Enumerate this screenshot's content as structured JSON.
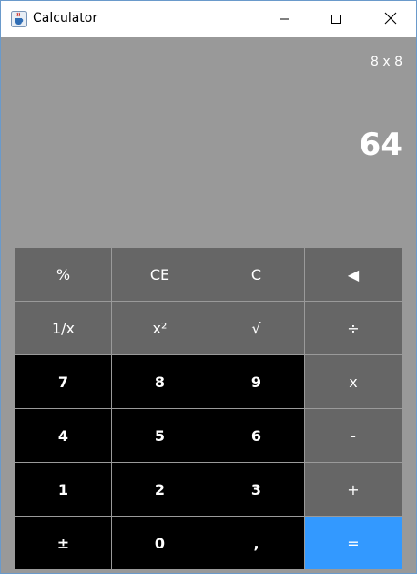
{
  "window": {
    "title": "Calculator"
  },
  "display": {
    "expression": "8 x 8",
    "result": "64"
  },
  "keypad": {
    "rows": [
      [
        {
          "label": "%",
          "kind": "fn"
        },
        {
          "label": "CE",
          "kind": "fn"
        },
        {
          "label": "C",
          "kind": "fn"
        },
        {
          "label": "◀",
          "kind": "fn"
        }
      ],
      [
        {
          "label": "1/x",
          "kind": "fn"
        },
        {
          "label": "x²",
          "kind": "fn"
        },
        {
          "label": "√",
          "kind": "fn"
        },
        {
          "label": "÷",
          "kind": "op"
        }
      ],
      [
        {
          "label": "7",
          "kind": "num"
        },
        {
          "label": "8",
          "kind": "num"
        },
        {
          "label": "9",
          "kind": "num"
        },
        {
          "label": "x",
          "kind": "op"
        }
      ],
      [
        {
          "label": "4",
          "kind": "num"
        },
        {
          "label": "5",
          "kind": "num"
        },
        {
          "label": "6",
          "kind": "num"
        },
        {
          "label": "-",
          "kind": "op"
        }
      ],
      [
        {
          "label": "1",
          "kind": "num"
        },
        {
          "label": "2",
          "kind": "num"
        },
        {
          "label": "3",
          "kind": "num"
        },
        {
          "label": "+",
          "kind": "op"
        }
      ],
      [
        {
          "label": "±",
          "kind": "num"
        },
        {
          "label": "0",
          "kind": "num"
        },
        {
          "label": ",",
          "kind": "num"
        },
        {
          "label": "=",
          "kind": "eq"
        }
      ]
    ]
  },
  "colors": {
    "display_bg": "#999999",
    "function_key": "#666666",
    "number_key": "#000000",
    "equals_key": "#3399ff",
    "text": "#ffffff"
  },
  "icons": {
    "app": "java-cup-icon",
    "minimize": "minimize-icon",
    "maximize": "maximize-icon",
    "close": "close-icon"
  }
}
